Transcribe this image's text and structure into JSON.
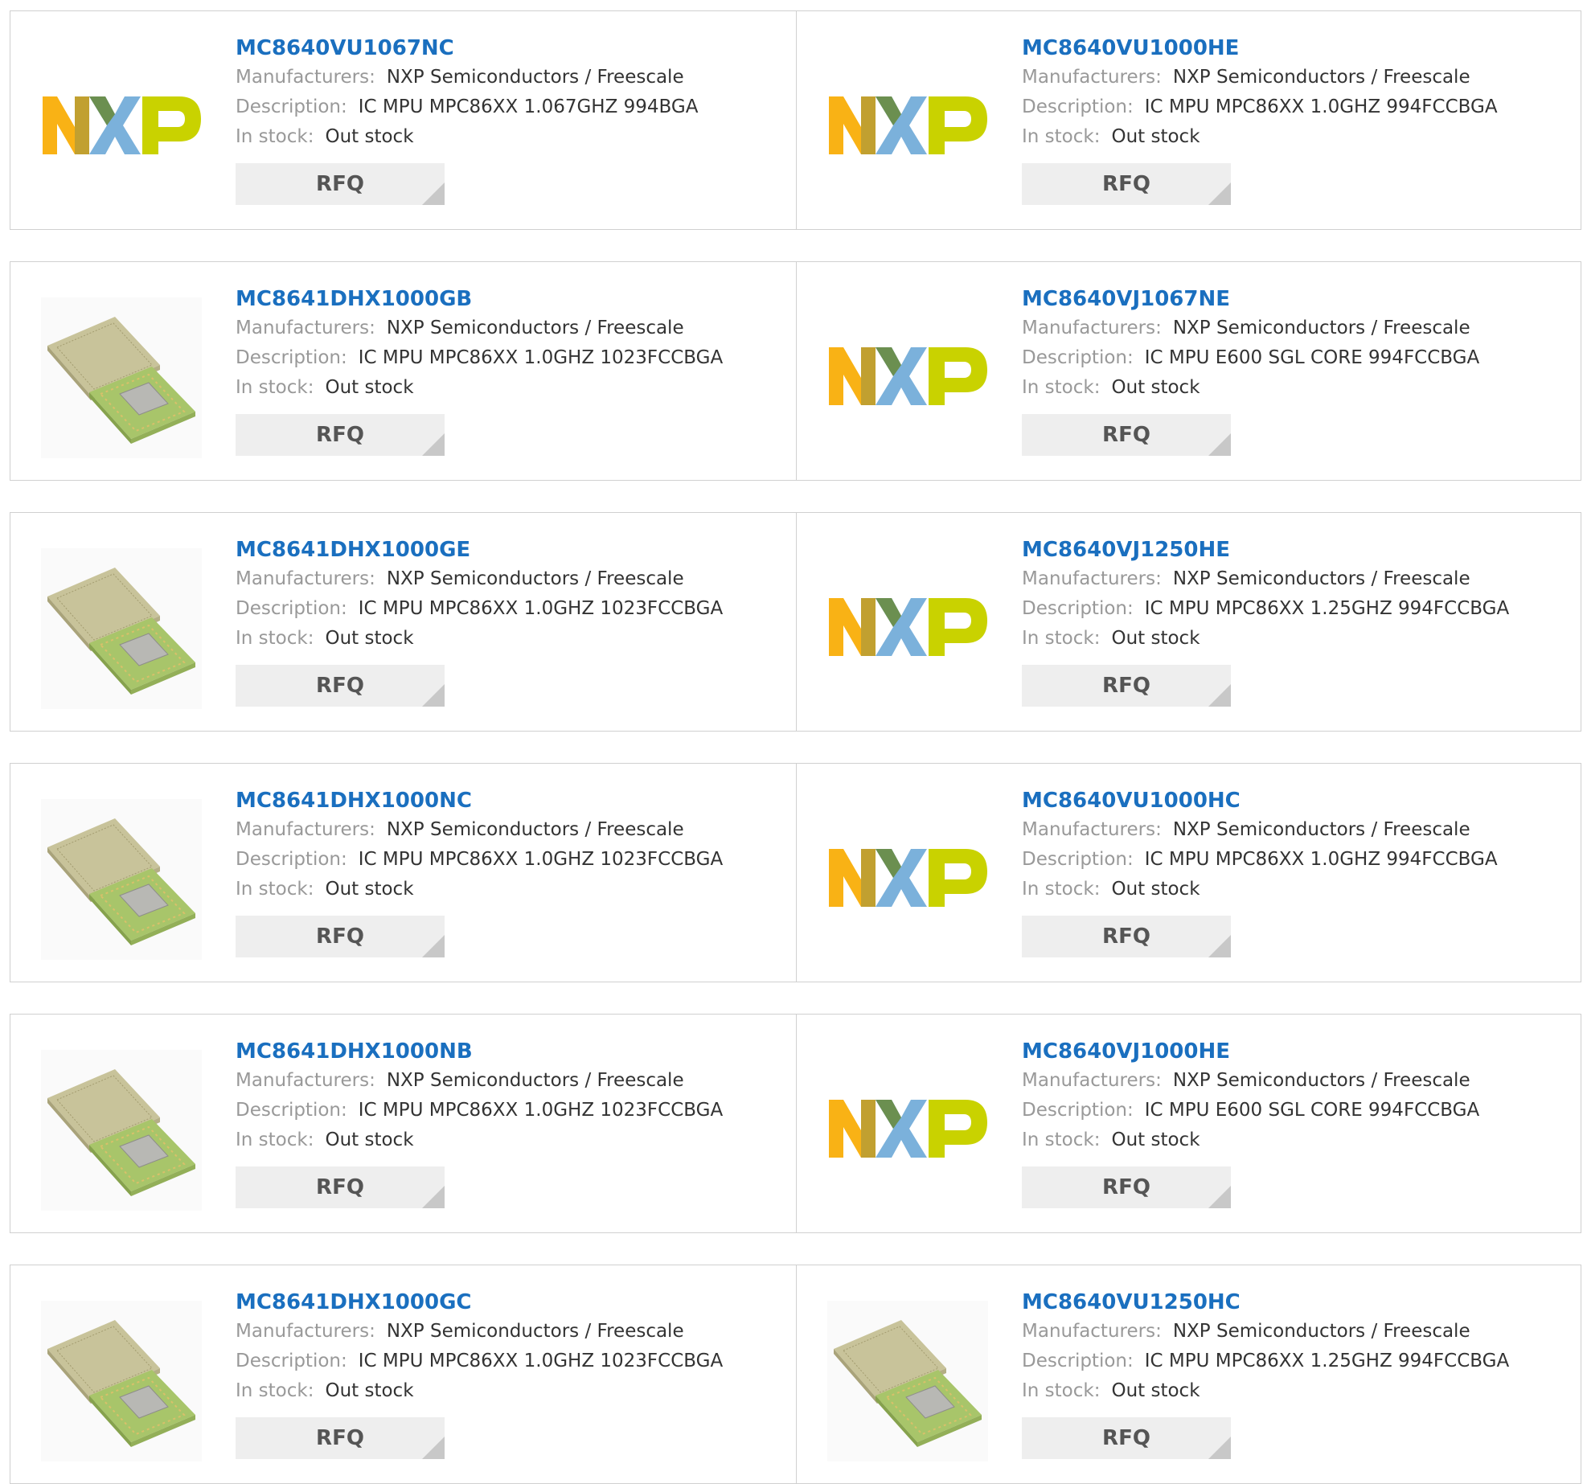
{
  "labels": {
    "manufacturers": "Manufacturers:",
    "description": "Description:",
    "in_stock": "In stock:",
    "rfq": "RFQ"
  },
  "brand_colors": {
    "nxp_orange": "#f9b215",
    "nxp_blue": "#7bb1db",
    "nxp_green": "#c9d200"
  },
  "link_color": "#1a6fbf",
  "products": [
    {
      "part": "MC8640VU1067NC",
      "manufacturer": "NXP Semiconductors / Freescale",
      "description": "IC MPU MPC86XX 1.067GHZ 994BGA",
      "stock": "Out stock",
      "image": "nxp-logo"
    },
    {
      "part": "MC8640VU1000HE",
      "manufacturer": "NXP Semiconductors / Freescale",
      "description": "IC MPU MPC86XX 1.0GHZ 994FCCBGA",
      "stock": "Out stock",
      "image": "nxp-logo"
    },
    {
      "part": "MC8641DHX1000GB",
      "manufacturer": "NXP Semiconductors / Freescale",
      "description": "IC MPU MPC86XX 1.0GHZ 1023FCCBGA",
      "stock": "Out stock",
      "image": "bga-chip"
    },
    {
      "part": "MC8640VJ1067NE",
      "manufacturer": "NXP Semiconductors / Freescale",
      "description": "IC MPU E600 SGL CORE 994FCCBGA",
      "stock": "Out stock",
      "image": "nxp-logo"
    },
    {
      "part": "MC8641DHX1000GE",
      "manufacturer": "NXP Semiconductors / Freescale",
      "description": "IC MPU MPC86XX 1.0GHZ 1023FCCBGA",
      "stock": "Out stock",
      "image": "bga-chip"
    },
    {
      "part": "MC8640VJ1250HE",
      "manufacturer": "NXP Semiconductors / Freescale",
      "description": "IC MPU MPC86XX 1.25GHZ 994FCCBGA",
      "stock": "Out stock",
      "image": "nxp-logo"
    },
    {
      "part": "MC8641DHX1000NC",
      "manufacturer": "NXP Semiconductors / Freescale",
      "description": "IC MPU MPC86XX 1.0GHZ 1023FCCBGA",
      "stock": "Out stock",
      "image": "bga-chip"
    },
    {
      "part": "MC8640VU1000HC",
      "manufacturer": "NXP Semiconductors / Freescale",
      "description": "IC MPU MPC86XX 1.0GHZ 994FCCBGA",
      "stock": "Out stock",
      "image": "nxp-logo"
    },
    {
      "part": "MC8641DHX1000NB",
      "manufacturer": "NXP Semiconductors / Freescale",
      "description": "IC MPU MPC86XX 1.0GHZ 1023FCCBGA",
      "stock": "Out stock",
      "image": "bga-chip"
    },
    {
      "part": "MC8640VJ1000HE",
      "manufacturer": "NXP Semiconductors / Freescale",
      "description": "IC MPU E600 SGL CORE 994FCCBGA",
      "stock": "Out stock",
      "image": "nxp-logo"
    },
    {
      "part": "MC8641DHX1000GC",
      "manufacturer": "NXP Semiconductors / Freescale",
      "description": "IC MPU MPC86XX 1.0GHZ 1023FCCBGA",
      "stock": "Out stock",
      "image": "bga-chip"
    },
    {
      "part": "MC8640VU1250HC",
      "manufacturer": "NXP Semiconductors / Freescale",
      "description": "IC MPU MPC86XX 1.25GHZ 994FCCBGA",
      "stock": "Out stock",
      "image": "bga-chip"
    }
  ]
}
